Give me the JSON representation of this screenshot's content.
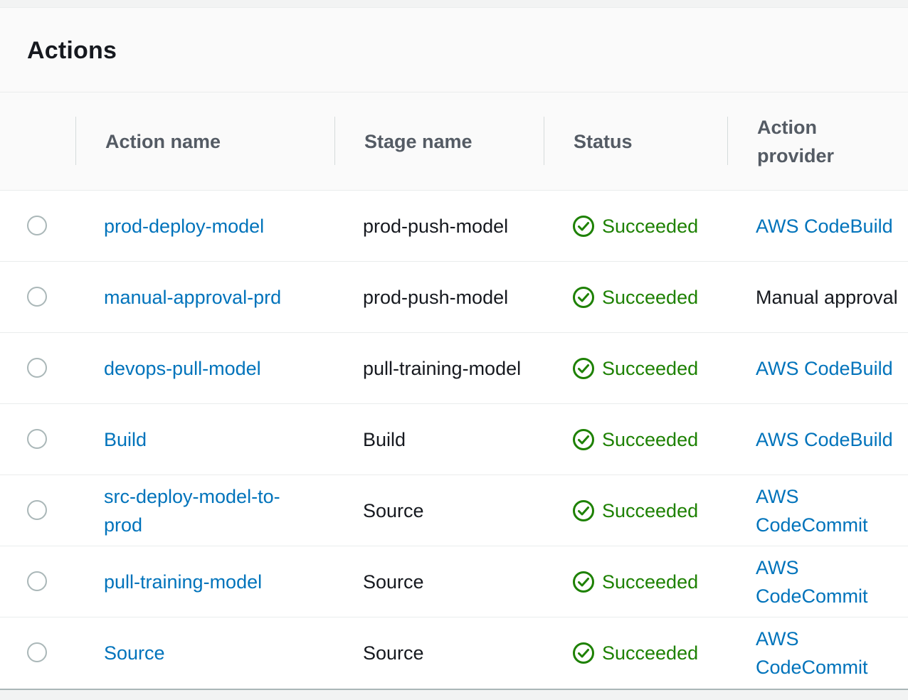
{
  "panel": {
    "title": "Actions"
  },
  "columns": {
    "action_name": "Action name",
    "stage_name": "Stage name",
    "status": "Status",
    "action_provider": "Action provider"
  },
  "rows": [
    {
      "action_name": "prod-deploy-model",
      "stage_name": "prod-push-model",
      "status": "Succeeded",
      "provider": "AWS CodeBuild",
      "provider_is_link": true
    },
    {
      "action_name": "manual-approval-prd",
      "stage_name": "prod-push-model",
      "status": "Succeeded",
      "provider": "Manual approval",
      "provider_is_link": false
    },
    {
      "action_name": "devops-pull-model",
      "stage_name": "pull-training-model",
      "status": "Succeeded",
      "provider": "AWS CodeBuild",
      "provider_is_link": true
    },
    {
      "action_name": "Build",
      "stage_name": "Build",
      "status": "Succeeded",
      "provider": "AWS CodeBuild",
      "provider_is_link": true
    },
    {
      "action_name": "src-deploy-model-to-prod",
      "stage_name": "Source",
      "status": "Succeeded",
      "provider": "AWS CodeCommit",
      "provider_is_link": true
    },
    {
      "action_name": "pull-training-model",
      "stage_name": "Source",
      "status": "Succeeded",
      "provider": "AWS CodeCommit",
      "provider_is_link": true
    },
    {
      "action_name": "Source",
      "stage_name": "Source",
      "status": "Succeeded",
      "provider": "AWS CodeCommit",
      "provider_is_link": true
    }
  ],
  "icons": {
    "status": "check-circle-icon"
  },
  "colors": {
    "link": "#0073bb",
    "success": "#1d8102"
  }
}
